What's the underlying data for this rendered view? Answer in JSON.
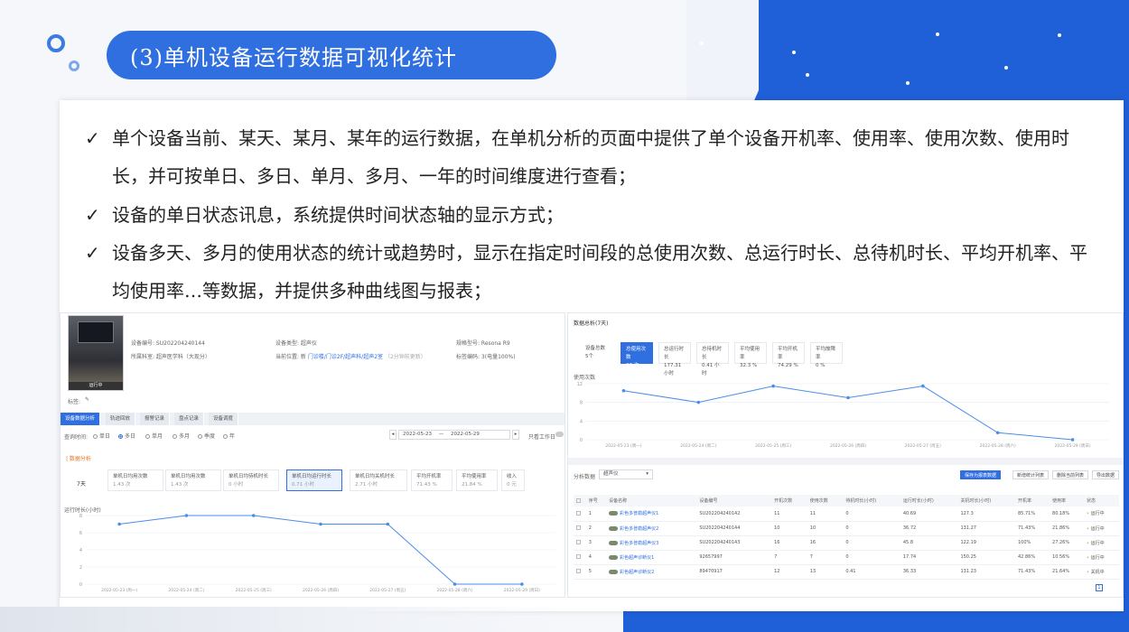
{
  "header": {
    "title": "(3)单机设备运行数据可视化统计"
  },
  "bullets": [
    "单个设备当前、某天、某月、某年的运行数据，在单机分析的页面中提供了单个设备开机率、使用率、使用次数、使用时长，并可按单日、多日、单月、多月、一年的时间维度进行查看；",
    "设备的单日状态讯息，系统提供时间状态轴的显示方式；",
    "设备多天、多月的使用状态的统计或趋势时，显示在指定时间段的总使用次数、总运行时长、总待机时长、平均开机率、平均使用率…等数据，并提供多种曲线图与报表；"
  ],
  "check_glyph": "✓",
  "left": {
    "device_status": "运行中",
    "info": {
      "device_no": "设备编号: SU202204240144",
      "device_type": "设备类型: 超声仪",
      "model": "规格型号: Resona R9",
      "dept": "所属科室: 超声医学科（大现分）",
      "location": "当前位置: 新",
      "location_link": "门诊楼/门诊2F/超声科/超声2室",
      "location_note": "（2分钟前更新）",
      "tag": "标签编码: 3(电量100%)"
    },
    "mark_label": "标签:",
    "tabs": [
      "设备数据分析",
      "轨迹回放",
      "报警记录",
      "盘点记录",
      "设备调度"
    ],
    "query": {
      "label": "查询时间:",
      "options": [
        "单日",
        "多日",
        "单月",
        "多月",
        "季度",
        "年"
      ],
      "selected": 1,
      "date_start": "2022-05-23",
      "sep": "—",
      "date_end": "2022-05-29",
      "switch_label": "只看工作日"
    },
    "section_title": "| 数据分析",
    "days_label": "7天",
    "stats": [
      {
        "label": "单机日均用次数",
        "value": "1.43 次"
      },
      {
        "label": "单机日均用次数",
        "value": "1.43 次"
      },
      {
        "label": "单机日均待机时长",
        "value": "0 小时"
      },
      {
        "label": "单机日均运行时长",
        "value": "0.71 小时"
      },
      {
        "label": "单机日均关机时长",
        "value": "2.71 小时"
      },
      {
        "label": "平均开机率",
        "value": "71.43 %"
      },
      {
        "label": "平均使用率",
        "value": "21.84 %"
      },
      {
        "label": "收入",
        "value": "0 元"
      }
    ],
    "chart_ylabel": "运行时长(小时)",
    "chart_yticks": [
      "8",
      "6",
      "4",
      "2",
      "0"
    ]
  },
  "right": {
    "title": "数据总析(7天)",
    "kpis": [
      {
        "label": "设备总数",
        "value": "5个"
      },
      {
        "label": "总使用次数",
        "value": "37 次"
      },
      {
        "label": "总运行时长",
        "value": "177.31 小时"
      },
      {
        "label": "总待机时长",
        "value": "0.41 小时"
      },
      {
        "label": "平均使用率",
        "value": "32.3 %"
      },
      {
        "label": "平均开机率",
        "value": "74.29 %"
      },
      {
        "label": "平均故障率",
        "value": "0 %"
      }
    ],
    "chart_ylabel": "使用次数",
    "chart_yticks": [
      "12",
      "8",
      "4",
      "0"
    ],
    "table_section": "分析数据",
    "select_value": "超声仪",
    "buttons": [
      "保存为报表数据",
      "新增统计列表",
      "删除当前列表",
      "导出数据"
    ],
    "table": {
      "headers": [
        "序号",
        "设备名称",
        "设备编号",
        "开机次数",
        "使用次数",
        "待机时长(小时)",
        "运行时长(小时)",
        "关机时长(小时)",
        "开机率",
        "使用率",
        "状态"
      ],
      "rows": [
        [
          "1",
          "彩色多普勒超声仪1",
          "SU202204240142",
          "11",
          "11",
          "0",
          "40.69",
          "127.3",
          "85.71%",
          "80.18%",
          "运行中"
        ],
        [
          "2",
          "彩色多普勒超声仪2",
          "SU202204240144",
          "10",
          "10",
          "0",
          "36.72",
          "131.27",
          "71.43%",
          "21.86%",
          "运行中"
        ],
        [
          "3",
          "彩色多普勒超声仪3",
          "SU202204240143",
          "16",
          "16",
          "0",
          "45.8",
          "122.19",
          "100%",
          "27.26%",
          "运行中"
        ],
        [
          "4",
          "彩色超声诊断仪1",
          "92657997",
          "7",
          "7",
          "0",
          "17.74",
          "150.25",
          "42.86%",
          "10.56%",
          "运行中"
        ],
        [
          "5",
          "彩色超声诊断仪2",
          "89470917",
          "12",
          "13",
          "0.41",
          "36.33",
          "131.23",
          "71.43%",
          "21.64%",
          "关机中"
        ]
      ]
    },
    "page": "1"
  },
  "chart_data": [
    {
      "type": "line",
      "title": "",
      "ylabel": "运行时长(小时)",
      "categories": [
        "2022-05-23 (周一)",
        "2022-05-24 (周二)",
        "2022-05-25 (周三)",
        "2022-05-26 (周四)",
        "2022-05-27 (周五)",
        "2022-05-28 (周六)",
        "2022-05-29 (周日)"
      ],
      "values": [
        7,
        8,
        8,
        7,
        7,
        0,
        0
      ],
      "ylim": [
        0,
        8
      ],
      "color": "#4a8de8"
    },
    {
      "type": "line",
      "title": "",
      "ylabel": "使用次数",
      "categories": [
        "2022-05-23 (周一)",
        "2022-05-24 (周二)",
        "2022-05-25 (周三)",
        "2022-05-26 (周四)",
        "2022-05-27 (周五)",
        "2022-05-28 (周六)",
        "2022-05-29 (周日)"
      ],
      "values": [
        10.5,
        8,
        11.5,
        9,
        11.5,
        1.5,
        0
      ],
      "ylim": [
        0,
        12
      ],
      "color": "#4a8de8"
    }
  ],
  "colors": {
    "accent": "#2f6fe0",
    "bg_blue": "#1f5fd8"
  }
}
